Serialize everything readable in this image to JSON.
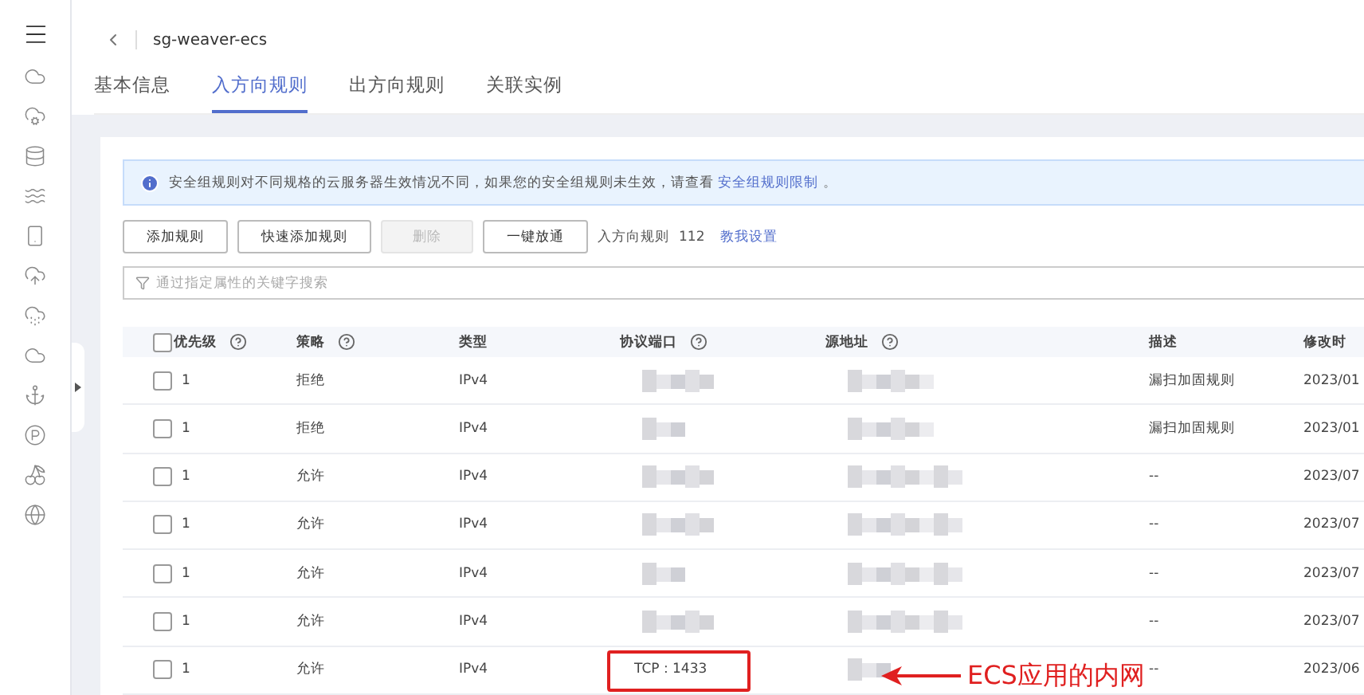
{
  "header": {
    "title": "sg-weaver-ecs"
  },
  "tabs": [
    {
      "label": "基本信息",
      "selected": false
    },
    {
      "label": "入方向规则",
      "selected": true
    },
    {
      "label": "出方向规则",
      "selected": false
    },
    {
      "label": "关联实例",
      "selected": false
    }
  ],
  "info_banner": {
    "text": "安全组规则对不同规格的云服务器生效情况不同，如果您的安全组规则未生效，请查看 ",
    "link": "安全组规则限制",
    "suffix": " 。"
  },
  "toolbar": {
    "buttons": [
      {
        "label": "添加规则",
        "disabled": false
      },
      {
        "label": "快速添加规则",
        "disabled": false
      },
      {
        "label": "删除",
        "disabled": true
      },
      {
        "label": "一键放通",
        "disabled": false
      }
    ],
    "rule_count_label": "入方向规则",
    "rule_count": "112",
    "help_link": "教我设置"
  },
  "search": {
    "placeholder": "通过指定属性的关键字搜索"
  },
  "table": {
    "header_checked": false,
    "columns": [
      {
        "label": "优先级",
        "help": true
      },
      {
        "label": "策略",
        "help": true
      },
      {
        "label": "类型",
        "help": false
      },
      {
        "label": "协议端口",
        "help": true
      },
      {
        "label": "源地址",
        "help": true
      },
      {
        "label": "描述",
        "help": false
      },
      {
        "label": "修改时",
        "help": false
      }
    ],
    "rows": [
      {
        "checked": false,
        "priority": "1",
        "policy": "拒绝",
        "type": "IPv4",
        "description": "漏扫加固规则",
        "modified": "2023/01"
      },
      {
        "checked": false,
        "priority": "1",
        "policy": "拒绝",
        "type": "IPv4",
        "description": "漏扫加固规则",
        "modified": "2023/01"
      },
      {
        "checked": false,
        "priority": "1",
        "policy": "允许",
        "type": "IPv4",
        "description": "--",
        "modified": "2023/07"
      },
      {
        "checked": false,
        "priority": "1",
        "policy": "允许",
        "type": "IPv4",
        "description": "--",
        "modified": "2023/07"
      },
      {
        "checked": false,
        "priority": "1",
        "policy": "允许",
        "type": "IPv4",
        "description": "--",
        "modified": "2023/07"
      },
      {
        "checked": false,
        "priority": "1",
        "policy": "允许",
        "type": "IPv4",
        "description": "--",
        "modified": "2023/07"
      },
      {
        "checked": false,
        "priority": "1",
        "policy": "允许",
        "type": "IPv4",
        "protocol_port": "TCP : 1433",
        "description": "--",
        "modified": "2023/06",
        "highlighted": true,
        "annotation": "ECS应用的内网"
      }
    ]
  }
}
